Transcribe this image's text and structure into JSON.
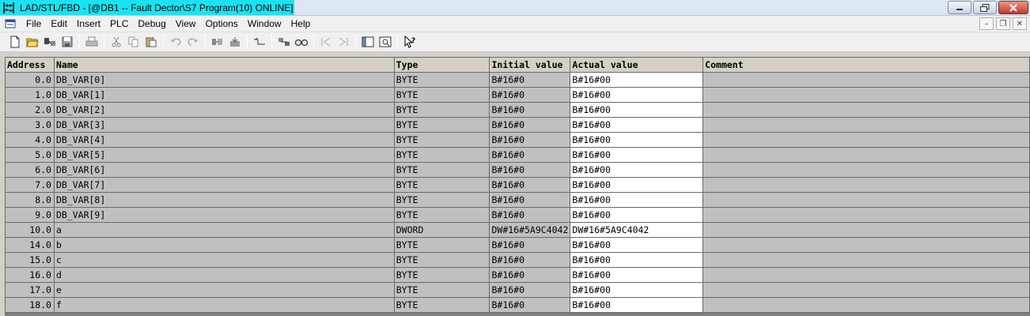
{
  "window": {
    "title": "LAD/STL/FBD  - [@DB1 -- Fault Dector\\S7 Program(10)  ONLINE]",
    "app_icon": "ladder-logic-icon"
  },
  "menu": [
    "File",
    "Edit",
    "Insert",
    "PLC",
    "Debug",
    "View",
    "Options",
    "Window",
    "Help"
  ],
  "toolbar": {
    "icons": [
      "new-icon",
      "open-icon",
      "online-offline-icon",
      "save-icon",
      "print-icon",
      "cut-icon",
      "copy-icon",
      "paste-icon",
      "undo-icon",
      "redo-icon",
      "download-icon",
      "upload-icon",
      "monitor-icon",
      "compare-icon",
      "glasses-icon",
      "prev-icon",
      "next-icon",
      "overview-icon",
      "zoom-icon",
      "help-pointer-icon"
    ]
  },
  "table": {
    "columns": [
      "Address",
      "Name",
      "Type",
      "Initial value",
      "Actual value",
      "Comment"
    ],
    "rows": [
      {
        "address": "0.0",
        "name": "DB_VAR[0]",
        "type": "BYTE",
        "initial": "B#16#0",
        "actual": "B#16#00",
        "comment": ""
      },
      {
        "address": "1.0",
        "name": "DB_VAR[1]",
        "type": "BYTE",
        "initial": "B#16#0",
        "actual": "B#16#00",
        "comment": ""
      },
      {
        "address": "2.0",
        "name": "DB_VAR[2]",
        "type": "BYTE",
        "initial": "B#16#0",
        "actual": "B#16#00",
        "comment": ""
      },
      {
        "address": "3.0",
        "name": "DB_VAR[3]",
        "type": "BYTE",
        "initial": "B#16#0",
        "actual": "B#16#00",
        "comment": ""
      },
      {
        "address": "4.0",
        "name": "DB_VAR[4]",
        "type": "BYTE",
        "initial": "B#16#0",
        "actual": "B#16#00",
        "comment": ""
      },
      {
        "address": "5.0",
        "name": "DB_VAR[5]",
        "type": "BYTE",
        "initial": "B#16#0",
        "actual": "B#16#00",
        "comment": ""
      },
      {
        "address": "6.0",
        "name": "DB_VAR[6]",
        "type": "BYTE",
        "initial": "B#16#0",
        "actual": "B#16#00",
        "comment": ""
      },
      {
        "address": "7.0",
        "name": "DB_VAR[7]",
        "type": "BYTE",
        "initial": "B#16#0",
        "actual": "B#16#00",
        "comment": ""
      },
      {
        "address": "8.0",
        "name": "DB_VAR[8]",
        "type": "BYTE",
        "initial": "B#16#0",
        "actual": "B#16#00",
        "comment": ""
      },
      {
        "address": "9.0",
        "name": "DB_VAR[9]",
        "type": "BYTE",
        "initial": "B#16#0",
        "actual": "B#16#00",
        "comment": ""
      },
      {
        "address": "10.0",
        "name": "a",
        "type": "DWORD",
        "initial": "DW#16#5A9C4042",
        "actual": "DW#16#5A9C4042",
        "comment": ""
      },
      {
        "address": "14.0",
        "name": "b",
        "type": "BYTE",
        "initial": "B#16#0",
        "actual": "B#16#00",
        "comment": ""
      },
      {
        "address": "15.0",
        "name": "c",
        "type": "BYTE",
        "initial": "B#16#0",
        "actual": "B#16#00",
        "comment": ""
      },
      {
        "address": "16.0",
        "name": "d",
        "type": "BYTE",
        "initial": "B#16#0",
        "actual": "B#16#00",
        "comment": ""
      },
      {
        "address": "17.0",
        "name": "e",
        "type": "BYTE",
        "initial": "B#16#0",
        "actual": "B#16#00",
        "comment": ""
      },
      {
        "address": "18.0",
        "name": "f",
        "type": "BYTE",
        "initial": "B#16#0",
        "actual": "B#16#00",
        "comment": ""
      }
    ]
  }
}
